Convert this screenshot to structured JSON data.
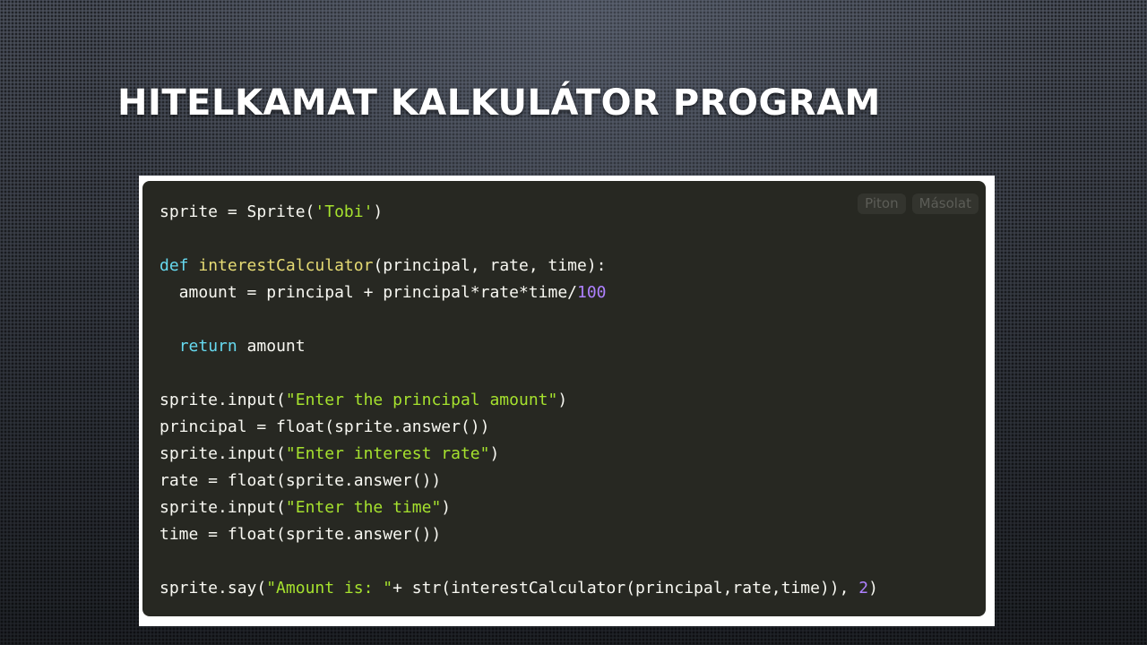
{
  "slide": {
    "title": "HITELKAMAT KALKULÁTOR PROGRAM"
  },
  "code_panel": {
    "language_label": "Piton",
    "copy_label": "Másolat",
    "lines": [
      [
        {
          "t": "sprite = Sprite(",
          "c": ""
        },
        {
          "t": "'Tobi'",
          "c": "str"
        },
        {
          "t": ")",
          "c": ""
        }
      ],
      [],
      [
        {
          "t": "def",
          "c": "kw"
        },
        {
          "t": " ",
          "c": ""
        },
        {
          "t": "interestCalculator",
          "c": "fn"
        },
        {
          "t": "(principal, rate, time):",
          "c": ""
        }
      ],
      [
        {
          "t": "  amount = principal + principal*rate*time/",
          "c": ""
        },
        {
          "t": "100",
          "c": "num"
        }
      ],
      [],
      [
        {
          "t": "  ",
          "c": ""
        },
        {
          "t": "return",
          "c": "kw"
        },
        {
          "t": " amount",
          "c": ""
        }
      ],
      [],
      [
        {
          "t": "sprite.input(",
          "c": ""
        },
        {
          "t": "\"Enter the principal amount\"",
          "c": "str"
        },
        {
          "t": ")",
          "c": ""
        }
      ],
      [
        {
          "t": "principal = float(sprite.answer())",
          "c": ""
        }
      ],
      [
        {
          "t": "sprite.input(",
          "c": ""
        },
        {
          "t": "\"Enter interest rate\"",
          "c": "str"
        },
        {
          "t": ")",
          "c": ""
        }
      ],
      [
        {
          "t": "rate = float(sprite.answer())",
          "c": ""
        }
      ],
      [
        {
          "t": "sprite.input(",
          "c": ""
        },
        {
          "t": "\"Enter the time\"",
          "c": "str"
        },
        {
          "t": ")",
          "c": ""
        }
      ],
      [
        {
          "t": "time = float(sprite.answer())",
          "c": ""
        }
      ],
      [],
      [
        {
          "t": "sprite.say(",
          "c": ""
        },
        {
          "t": "\"Amount is: \"",
          "c": "str"
        },
        {
          "t": "+ str(interestCalculator(principal,rate,time)), ",
          "c": ""
        },
        {
          "t": "2",
          "c": "num"
        },
        {
          "t": ")",
          "c": ""
        }
      ]
    ]
  },
  "colors": {
    "code_background": "#272822",
    "string": "#a6e22e",
    "keyword": "#66d9ef",
    "function_name": "#e6db74",
    "number": "#ae81ff",
    "plain_text": "#f8f8f2"
  }
}
